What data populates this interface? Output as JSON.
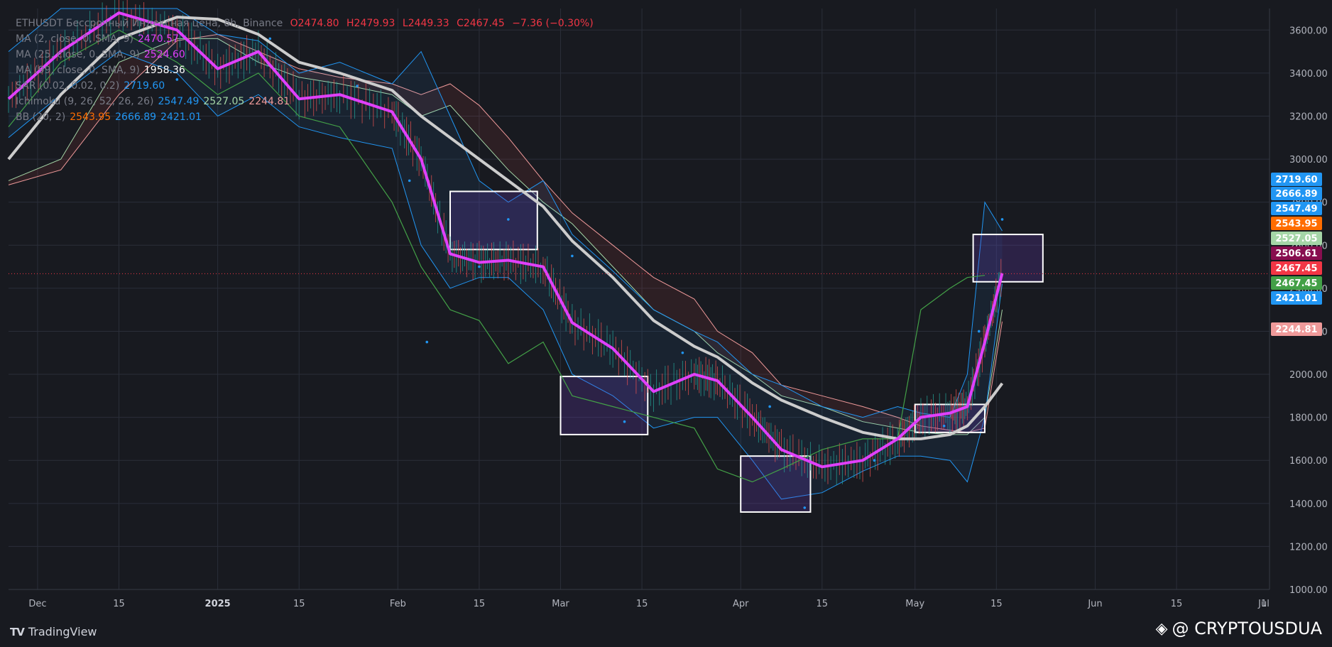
{
  "header": {
    "symbol_line": "ETHUSDT Бессрочный Индексная цена, 8h, Binance",
    "ohlc": {
      "o": "O2474.80",
      "h": "H2479.93",
      "l": "L2449.33",
      "c": "C2467.45",
      "chg": "−7.36 (−0.30%)"
    }
  },
  "indicators": [
    {
      "label": "MA (2, close, 0, SMA, 9)",
      "values": [
        "2470.57"
      ],
      "colors": [
        "#e040fb"
      ]
    },
    {
      "label": "MA (25, close, 0, SMA, 9)",
      "values": [
        "2524.60"
      ],
      "colors": [
        "#e040fb"
      ]
    },
    {
      "label": "MA (99, close, 0, SMA, 9)",
      "values": [
        "1958.36"
      ],
      "colors": [
        "#ffffff"
      ]
    },
    {
      "label": "SAR (0.02, 0.02, 0.2)",
      "values": [
        "2719.60"
      ],
      "colors": [
        "#2196f3"
      ]
    },
    {
      "label": "Ichimoku (9, 26, 52, 26, 26)",
      "values": [
        "2547.49",
        "2527.05",
        "2244.81"
      ],
      "colors": [
        "#2196f3",
        "#a5d6a7",
        "#ef9a9a"
      ]
    },
    {
      "label": "BB (20, 2)",
      "values": [
        "2543.95",
        "2666.89",
        "2421.01"
      ],
      "colors": [
        "#ff6d00",
        "#2196f3",
        "#2196f3"
      ]
    }
  ],
  "axis": {
    "y_ticks": [
      "3600.00",
      "3400.00",
      "3200.00",
      "3000.00",
      "2800.00",
      "2600.00",
      "2400.00",
      "2200.00",
      "2000.00",
      "1800.00",
      "1600.00",
      "1400.00",
      "1200.00",
      "1000.00"
    ],
    "x_ticks": [
      "Dec",
      "15",
      "2025",
      "15",
      "Feb",
      "15",
      "Mar",
      "15",
      "Apr",
      "15",
      "May",
      "15",
      "Jun",
      "15",
      "Jul",
      "1"
    ]
  },
  "price_labels": [
    {
      "text": "2719.60",
      "color": "#2196f3"
    },
    {
      "text": "2666.89",
      "color": "#2196f3"
    },
    {
      "text": "2547.49",
      "color": "#2196f3"
    },
    {
      "text": "2543.95",
      "color": "#ff6d00"
    },
    {
      "text": "2527.05",
      "color": "#a5d6a7"
    },
    {
      "text": "2506.61",
      "color": "#880e4f"
    },
    {
      "text": "2467.45",
      "color": "#f23645"
    },
    {
      "text": "2467.45",
      "color": "#43a047"
    },
    {
      "text": "2421.01",
      "color": "#2196f3"
    },
    {
      "text": "2244.81",
      "color": "#ef9a9a"
    }
  ],
  "footer": {
    "brand": "TradingView",
    "brand_mark": "TV",
    "watermark": "@ CRYPTOUSDUA"
  },
  "colors": {
    "bg": "#181a20",
    "grid": "#2a2e39",
    "up": "#26a69a",
    "down": "#ef5350",
    "ma_fast": "#e040fb",
    "ma_slow": "#cccccc",
    "bb": "#2196f3",
    "lagging": "#43a047",
    "cloud_edge": "#ef9a9a"
  },
  "chart_data": {
    "type": "line",
    "title": "ETHUSDT Бессрочный Индексная цена, 8h, Binance",
    "xlabel": "",
    "ylabel": "",
    "ylim": [
      1000,
      3700
    ],
    "x_range": [
      "2024-11-26",
      "2025-07-01"
    ],
    "x": [
      "2024-11-26",
      "2024-12-05",
      "2024-12-15",
      "2024-12-25",
      "2025-01-01",
      "2025-01-08",
      "2025-01-15",
      "2025-01-22",
      "2025-01-31",
      "2025-02-05",
      "2025-02-10",
      "2025-02-15",
      "2025-02-20",
      "2025-02-26",
      "2025-03-03",
      "2025-03-10",
      "2025-03-17",
      "2025-03-24",
      "2025-03-28",
      "2025-04-03",
      "2025-04-08",
      "2025-04-15",
      "2025-04-22",
      "2025-04-28",
      "2025-05-02",
      "2025-05-07",
      "2025-05-10",
      "2025-05-13",
      "2025-05-16"
    ],
    "series": [
      {
        "name": "MA (2, close, 0, SMA, 9)",
        "values": [
          3280,
          3500,
          3680,
          3600,
          3420,
          3500,
          3280,
          3300,
          3220,
          3000,
          2560,
          2520,
          2530,
          2500,
          2240,
          2120,
          1920,
          2000,
          1970,
          1800,
          1650,
          1570,
          1600,
          1700,
          1800,
          1820,
          1850,
          2150,
          2470
        ]
      },
      {
        "name": "MA (99, close, 0, SMA, 9)",
        "values": [
          3000,
          3300,
          3560,
          3660,
          3650,
          3580,
          3450,
          3400,
          3320,
          3200,
          3100,
          3000,
          2900,
          2780,
          2620,
          2450,
          2250,
          2130,
          2080,
          1960,
          1880,
          1800,
          1730,
          1700,
          1700,
          1720,
          1760,
          1850,
          1958
        ]
      },
      {
        "name": "BB (20, 2) upper",
        "values": [
          3500,
          3700,
          3700,
          3700,
          3580,
          3550,
          3400,
          3450,
          3350,
          3500,
          3200,
          2900,
          2800,
          2900,
          2650,
          2480,
          2300,
          2200,
          2150,
          2000,
          1950,
          1850,
          1800,
          1850,
          1820,
          1800,
          2000,
          2800,
          2667
        ]
      },
      {
        "name": "BB (20, 2) lower",
        "values": [
          3100,
          3300,
          3500,
          3400,
          3200,
          3300,
          3150,
          3100,
          3050,
          2600,
          2400,
          2450,
          2450,
          2300,
          2000,
          1900,
          1750,
          1800,
          1800,
          1600,
          1420,
          1450,
          1550,
          1620,
          1620,
          1600,
          1500,
          1800,
          2421
        ]
      },
      {
        "name": "Ichimoku lagging",
        "values": [
          3150,
          3450,
          3600,
          3450,
          3300,
          3400,
          3200,
          3150,
          2800,
          2500,
          2300,
          2250,
          2050,
          2150,
          1900,
          1850,
          1800,
          1750,
          1560,
          1500,
          1560,
          1650,
          1700,
          1700,
          2300,
          2400,
          2450,
          2460,
          null
        ]
      },
      {
        "name": "Ichimoku cloud A",
        "values": [
          2900,
          3000,
          3450,
          3560,
          3560,
          3450,
          3380,
          3350,
          3300,
          3200,
          3250,
          3100,
          2950,
          2800,
          2700,
          2500,
          2300,
          2200,
          2100,
          2000,
          1900,
          1850,
          1780,
          1750,
          1730,
          1720,
          1720,
          1800,
          2300
        ]
      },
      {
        "name": "Ichimoku cloud B",
        "values": [
          2880,
          2950,
          3300,
          3550,
          3580,
          3500,
          3420,
          3380,
          3350,
          3300,
          3350,
          3250,
          3100,
          2900,
          2750,
          2600,
          2450,
          2350,
          2200,
          2100,
          1950,
          1900,
          1850,
          1800,
          1760,
          1740,
          1730,
          1750,
          2245
        ]
      }
    ],
    "sar_points": [
      {
        "x": "2024-12-10",
        "y": 3600
      },
      {
        "x": "2024-12-25",
        "y": 3370
      },
      {
        "x": "2025-01-10",
        "y": 3560
      },
      {
        "x": "2025-01-25",
        "y": 3340
      },
      {
        "x": "2025-02-03",
        "y": 2900
      },
      {
        "x": "2025-02-06",
        "y": 2150
      },
      {
        "x": "2025-02-15",
        "y": 2500
      },
      {
        "x": "2025-02-20",
        "y": 2720
      },
      {
        "x": "2025-03-03",
        "y": 2550
      },
      {
        "x": "2025-03-12",
        "y": 1780
      },
      {
        "x": "2025-03-22",
        "y": 2100
      },
      {
        "x": "2025-04-06",
        "y": 1850
      },
      {
        "x": "2025-04-12",
        "y": 1380
      },
      {
        "x": "2025-04-24",
        "y": 1600
      },
      {
        "x": "2025-05-06",
        "y": 1760
      },
      {
        "x": "2025-05-12",
        "y": 2200
      },
      {
        "x": "2025-05-16",
        "y": 2720
      }
    ],
    "zones": [
      {
        "x0": "2025-02-10",
        "x1": "2025-02-25",
        "y0": 2580,
        "y1": 2850
      },
      {
        "x0": "2025-03-01",
        "x1": "2025-03-16",
        "y0": 1720,
        "y1": 1990
      },
      {
        "x0": "2025-04-01",
        "x1": "2025-04-13",
        "y0": 1360,
        "y1": 1620
      },
      {
        "x0": "2025-05-01",
        "x1": "2025-05-13",
        "y0": 1730,
        "y1": 1860
      },
      {
        "x0": "2025-05-11",
        "x1": "2025-05-23",
        "y0": 2430,
        "y1": 2650
      }
    ],
    "last_price": 2467.45
  }
}
